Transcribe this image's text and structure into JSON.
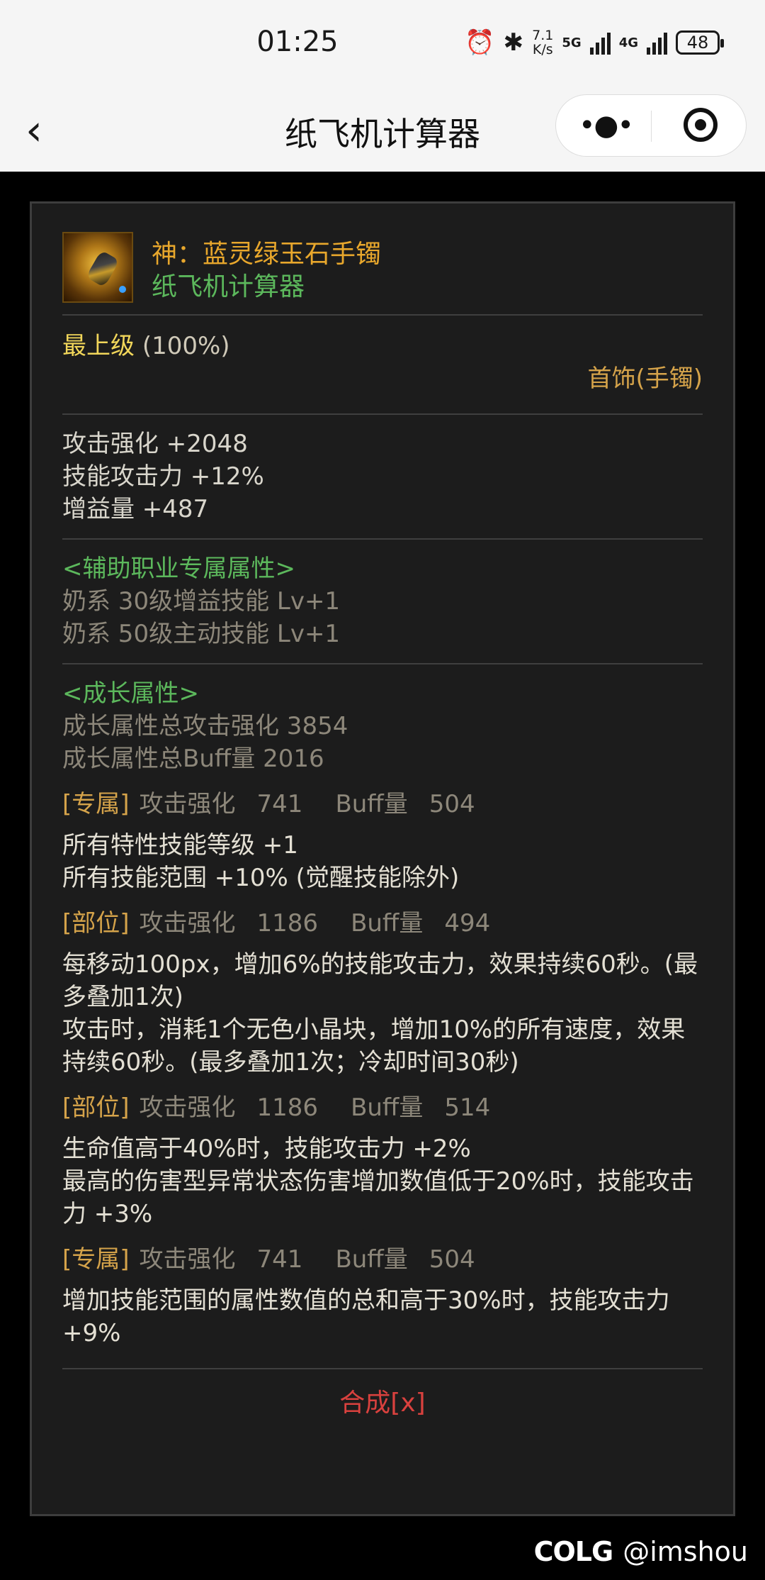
{
  "status_bar": {
    "time": "01:25",
    "net_speed_value": "7.1",
    "net_speed_unit": "K/s",
    "sim1_label": "5G",
    "sim2_label": "4G",
    "battery": "48"
  },
  "nav": {
    "title": "纸飞机计算器",
    "back_icon": "chevron-left-icon",
    "more_icon": "more-dots-icon",
    "close_icon": "target-close-icon"
  },
  "item": {
    "name": "神：蓝灵绿玉石手镯",
    "source": "纸飞机计算器",
    "grade": "最上级",
    "grade_percent": "(100%)",
    "slot_type": "首饰(手镯)"
  },
  "base_stats": [
    "攻击强化 +2048",
    "技能攻击力 +12%",
    "增益量 +487"
  ],
  "support_section": {
    "header": "<辅助职业专属属性>",
    "lines": [
      "奶系 30级增益技能 Lv+1",
      "奶系 50级主动技能 Lv+1"
    ]
  },
  "growth_section": {
    "header": "<成长属性>",
    "total_attack": "成长属性总攻击强化 3854",
    "total_buff": "成长属性总Buff量 2016"
  },
  "options": [
    {
      "tag": "[专属]",
      "stat_label": "攻击强化",
      "stat_value": "741",
      "buff_label": "Buff量",
      "buff_value": "504",
      "desc": [
        "所有特性技能等级 +1",
        "所有技能范围 +10% (觉醒技能除外)"
      ]
    },
    {
      "tag": "[部位]",
      "stat_label": "攻击强化",
      "stat_value": "1186",
      "buff_label": "Buff量",
      "buff_value": "494",
      "desc": [
        "每移动100px，增加6%的技能攻击力，效果持续60秒。(最多叠加1次)",
        "攻击时，消耗1个无色小晶块，增加10%的所有速度，效果持续60秒。(最多叠加1次；冷却时间30秒)"
      ]
    },
    {
      "tag": "[部位]",
      "stat_label": "攻击强化",
      "stat_value": "1186",
      "buff_label": "Buff量",
      "buff_value": "514",
      "desc": [
        "生命值高于40%时，技能攻击力 +2%",
        "最高的伤害型异常状态伤害增加数值低于20%时，技能攻击力 +3%"
      ]
    },
    {
      "tag": "[专属]",
      "stat_label": "攻击强化",
      "stat_value": "741",
      "buff_label": "Buff量",
      "buff_value": "504",
      "desc": [
        "增加技能范围的属性数值的总和高于30%时，技能攻击力 +9%"
      ]
    }
  ],
  "compose_label": "合成[x]",
  "watermark": {
    "logo": "COLG",
    "handle": "@imshou"
  }
}
